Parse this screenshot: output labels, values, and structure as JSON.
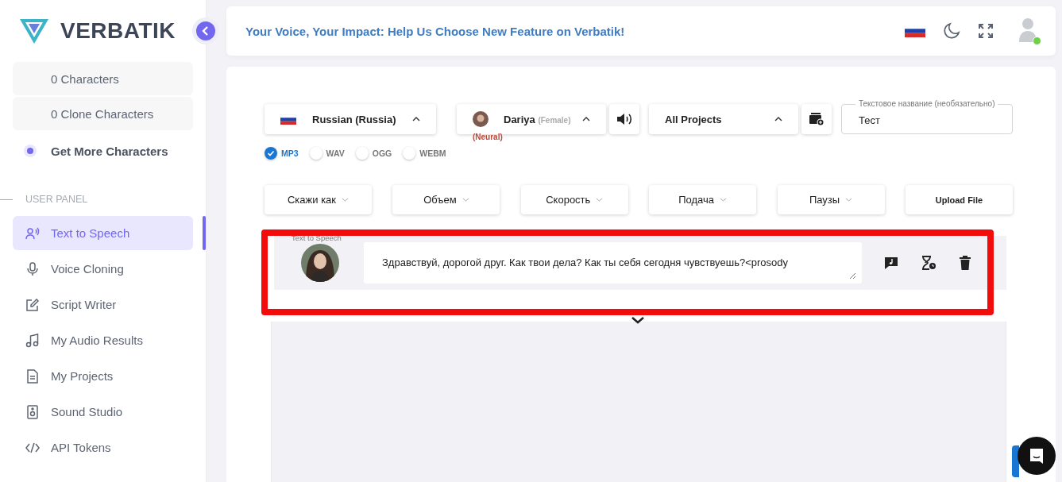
{
  "brand": {
    "name": "VERBATIK"
  },
  "credits": [
    {
      "label": "0 Characters"
    },
    {
      "label": "0 Clone Characters"
    }
  ],
  "get_more": {
    "label": "Get More Characters"
  },
  "section_label": "USER PANEL",
  "nav": [
    {
      "label": "Text to Speech",
      "selected": true
    },
    {
      "label": "Voice Cloning",
      "selected": false
    },
    {
      "label": "Script Writer",
      "selected": false
    },
    {
      "label": "My Audio Results",
      "selected": false
    },
    {
      "label": "My Projects",
      "selected": false
    },
    {
      "label": "Sound Studio",
      "selected": false
    },
    {
      "label": "API Tokens",
      "selected": false
    }
  ],
  "banner": "Your Voice, Your Impact: Help Us Choose New Feature on Verbatik!",
  "user": {
    "online": true
  },
  "language": {
    "label": "Russian (Russia)"
  },
  "voice": {
    "name": "Dariya",
    "gender": "(Female)",
    "type": "(Neural)"
  },
  "project": {
    "label": "All Projects"
  },
  "title_field": {
    "label": "Текстовое название (необязательно)",
    "value": "Тест"
  },
  "formats": [
    {
      "label": "MP3",
      "selected": true
    },
    {
      "label": "WAV",
      "selected": false
    },
    {
      "label": "OGG",
      "selected": false
    },
    {
      "label": "WEBM",
      "selected": false
    }
  ],
  "tools": [
    {
      "label": "Скажи как",
      "kind": "dropdown"
    },
    {
      "label": "Объем",
      "kind": "dropdown"
    },
    {
      "label": "Скорость",
      "kind": "dropdown"
    },
    {
      "label": "Подача",
      "kind": "dropdown"
    },
    {
      "label": "Паузы",
      "kind": "dropdown"
    },
    {
      "label": "Upload File",
      "kind": "button"
    }
  ],
  "editor": {
    "label": "Text to Speech",
    "text": "Здравствуй, дорогой друг. Как твои дела? Как ты себя сегодня чувствуешь?<prosody"
  }
}
